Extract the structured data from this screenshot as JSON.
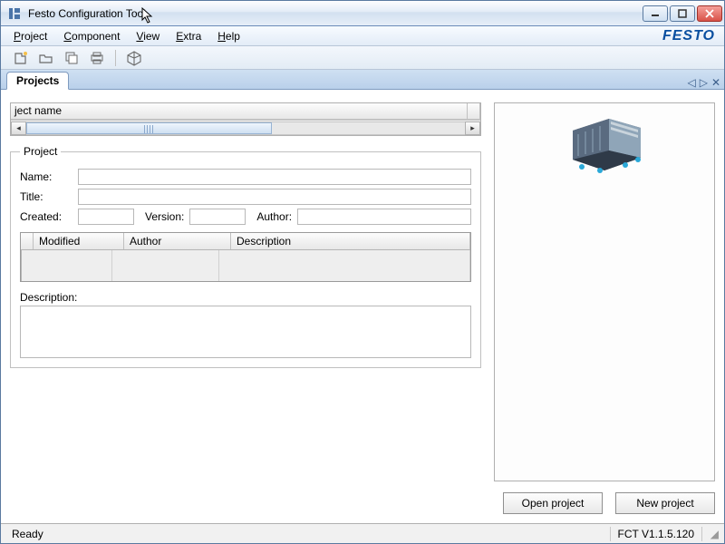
{
  "window": {
    "title": "Festo Configuration Tool"
  },
  "menu": {
    "project": "Project",
    "component": "Component",
    "view": "View",
    "extra": "Extra",
    "help": "Help",
    "brand": "FESTO"
  },
  "toolbar_icons": {
    "new": "new-project-icon",
    "open": "open-project-icon",
    "stack": "stack-icon",
    "print": "print-icon",
    "cube": "cube-icon"
  },
  "tabs": {
    "projects": "Projects"
  },
  "tab_extras": {
    "prev": "◁",
    "next": "▷",
    "close": "✕"
  },
  "project_list": {
    "column_header": "ject name",
    "rows": []
  },
  "project_panel": {
    "legend": "Project",
    "labels": {
      "name": "Name:",
      "title": "Title:",
      "created": "Created:",
      "version": "Version:",
      "author": "Author:",
      "description": "Description:"
    },
    "fields": {
      "name": "",
      "title": "",
      "created": "",
      "version": "",
      "author": "",
      "description": ""
    },
    "grid": {
      "columns": {
        "modified": "Modified",
        "author": "Author",
        "description": "Description"
      },
      "rows": []
    }
  },
  "buttons": {
    "open_project": "Open project",
    "new_project": "New project"
  },
  "status": {
    "ready": "Ready",
    "version": "FCT V1.1.5.120"
  }
}
